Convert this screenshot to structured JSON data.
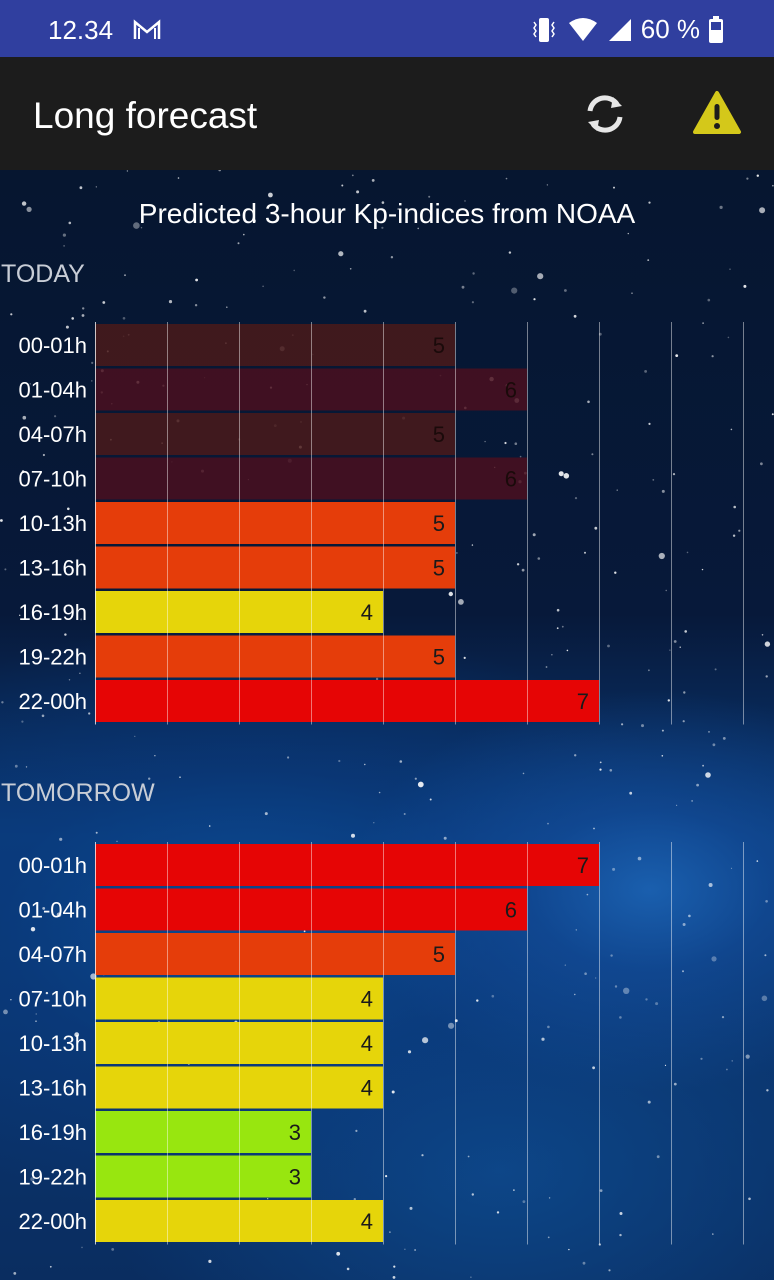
{
  "status_bar": {
    "time": "12.34",
    "battery": "60 %",
    "icons": [
      "gmail-icon",
      "vibrate-icon",
      "wifi-icon",
      "signal-icon",
      "battery-icon"
    ]
  },
  "app_bar": {
    "title": "Long forecast",
    "actions": [
      "refresh-icon",
      "warning-icon"
    ]
  },
  "colors": {
    "status_bar": "#303f9f",
    "app_bar": "#1c1c1c",
    "kp3": "#98e60f",
    "kp4": "#e6d50a",
    "kp5": "#e53d0a",
    "kp6plus": "#e60505",
    "past_kp5": "#4a1a1a",
    "past_kp6": "#4a0f1e"
  },
  "chart_data": [
    {
      "type": "bar",
      "orientation": "horizontal",
      "title": "Predicted 3-hour Kp-indices from NOAA",
      "section": "TODAY",
      "categories": [
        "00-01h",
        "01-04h",
        "04-07h",
        "07-10h",
        "10-13h",
        "13-16h",
        "16-19h",
        "19-22h",
        "22-00h"
      ],
      "values": [
        5,
        6,
        5,
        6,
        5,
        5,
        4,
        5,
        7
      ],
      "past": [
        true,
        true,
        true,
        true,
        false,
        false,
        false,
        false,
        false
      ],
      "xlim": [
        0,
        9
      ],
      "grid": true
    },
    {
      "type": "bar",
      "orientation": "horizontal",
      "title": "Predicted 3-hour Kp-indices from NOAA",
      "section": "TOMORROW",
      "categories": [
        "00-01h",
        "01-04h",
        "04-07h",
        "07-10h",
        "10-13h",
        "13-16h",
        "16-19h",
        "19-22h",
        "22-00h"
      ],
      "values": [
        7,
        6,
        5,
        4,
        4,
        4,
        3,
        3,
        4
      ],
      "past": [
        false,
        false,
        false,
        false,
        false,
        false,
        false,
        false,
        false
      ],
      "xlim": [
        0,
        9
      ],
      "grid": true
    }
  ]
}
